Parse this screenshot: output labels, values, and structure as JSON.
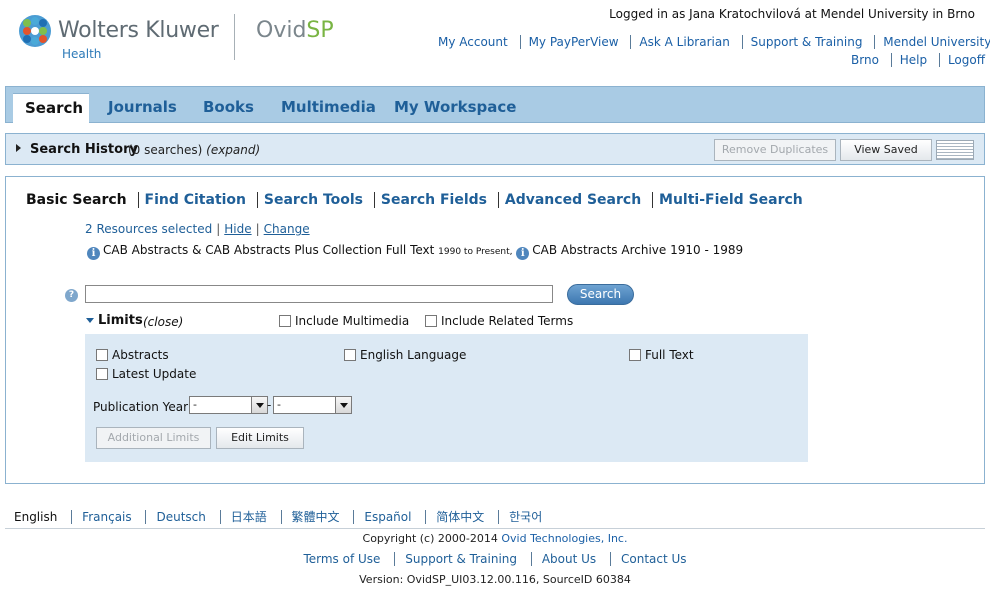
{
  "header": {
    "brand": "Wolters Kluwer",
    "brand_sub": "Health",
    "product_prefix": "Ovid",
    "product_suffix": "SP",
    "logged_in": "Logged in as Jana Kratochvilová at Mendel University in Brno",
    "links_row1": [
      "My Account",
      "My PayPerView",
      "Ask A Librarian",
      "Support & Training",
      "Mendel University in"
    ],
    "links_row2": [
      "Brno",
      "Help",
      "Logoff"
    ]
  },
  "tabs": [
    "Search",
    "Journals",
    "Books",
    "Multimedia",
    "My Workspace"
  ],
  "history": {
    "title": "Search History",
    "count": "(0 searches)",
    "expand": "(expand)",
    "remove_duplicates": "Remove Duplicates",
    "view_saved": "View Saved"
  },
  "subnav": [
    "Basic Search",
    "Find Citation",
    "Search Tools",
    "Search Fields",
    "Advanced Search",
    "Multi-Field Search"
  ],
  "resources": {
    "selected": "2 Resources selected",
    "hide": "Hide",
    "change": "Change",
    "db1_name": "CAB Abstracts & CAB Abstracts Plus Collection Full Text",
    "db1_range": "1990 to Present,",
    "db2_name": "CAB Abstracts Archive 1910 - 1989"
  },
  "search": {
    "value": "",
    "button": "Search"
  },
  "limits": {
    "title": "Limits",
    "close": "(close)",
    "include_multimedia": "Include Multimedia",
    "include_related": "Include Related Terms",
    "abstracts": "Abstracts",
    "english": "English Language",
    "full_text": "Full Text",
    "latest_update": "Latest Update",
    "pub_year_label": "Publication Year",
    "year_from": "-",
    "year_to": "-",
    "dash": "-",
    "additional_limits": "Additional Limits",
    "edit_limits": "Edit Limits"
  },
  "footer": {
    "languages": [
      "English",
      "Français",
      "Deutsch",
      "日本語",
      "繁體中文",
      "Español",
      "简体中文",
      "한국어"
    ],
    "copyright_prefix": "Copyright (c) 2000-2014",
    "copyright_company": "Ovid Technologies, Inc.",
    "links": [
      "Terms of Use",
      "Support & Training",
      "About Us",
      "Contact Us"
    ],
    "version": "Version: OvidSP_UI03.12.00.116, SourceID 60384"
  },
  "colors": {
    "tabbar": "#a9cbe4",
    "panel": "#dce9f4",
    "link": "#1f5f98",
    "ovid_green": "#79b443"
  }
}
